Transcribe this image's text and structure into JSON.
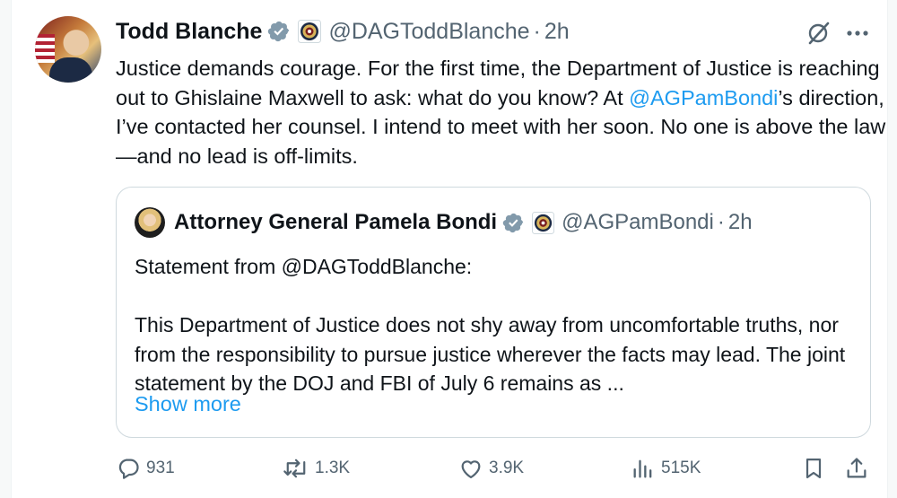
{
  "tweet": {
    "author_name": "Todd Blanche",
    "handle": "@DAGToddBlanche",
    "separator": "·",
    "time": "2h",
    "text_before": "Justice demands courage. For the first time, the Department of Justice is reaching out to Ghislaine Maxwell to ask: what do you know? At ",
    "mention": "@AGPamBondi",
    "text_after": "’s direction, I’ve contacted her counsel. I intend to meet with her soon. No one is above the law—and no lead is off-limits."
  },
  "quote": {
    "author_name": "Attorney General Pamela Bondi",
    "handle": "@AGPamBondi",
    "separator": "·",
    "time": "2h",
    "line1": "Statement from @DAGToddBlanche:",
    "paragraph": "This Department of Justice does not shy away from uncomfortable truths, nor from the responsibility to pursue justice wherever the facts may lead.  The joint statement by the DOJ and FBI of July 6 remains as ...",
    "show_more": "Show more"
  },
  "actions": {
    "replies": "931",
    "reposts": "1.3K",
    "likes": "3.9K",
    "views": "515K"
  },
  "colors": {
    "accent": "#1d9bf0",
    "muted": "#536471",
    "verified_badge": "#829aab"
  },
  "icons": [
    "verified-badge-icon",
    "doj-seal-icon",
    "grok-icon",
    "more-icon",
    "reply-icon",
    "repost-icon",
    "like-icon",
    "views-icon",
    "bookmark-icon",
    "share-icon"
  ]
}
